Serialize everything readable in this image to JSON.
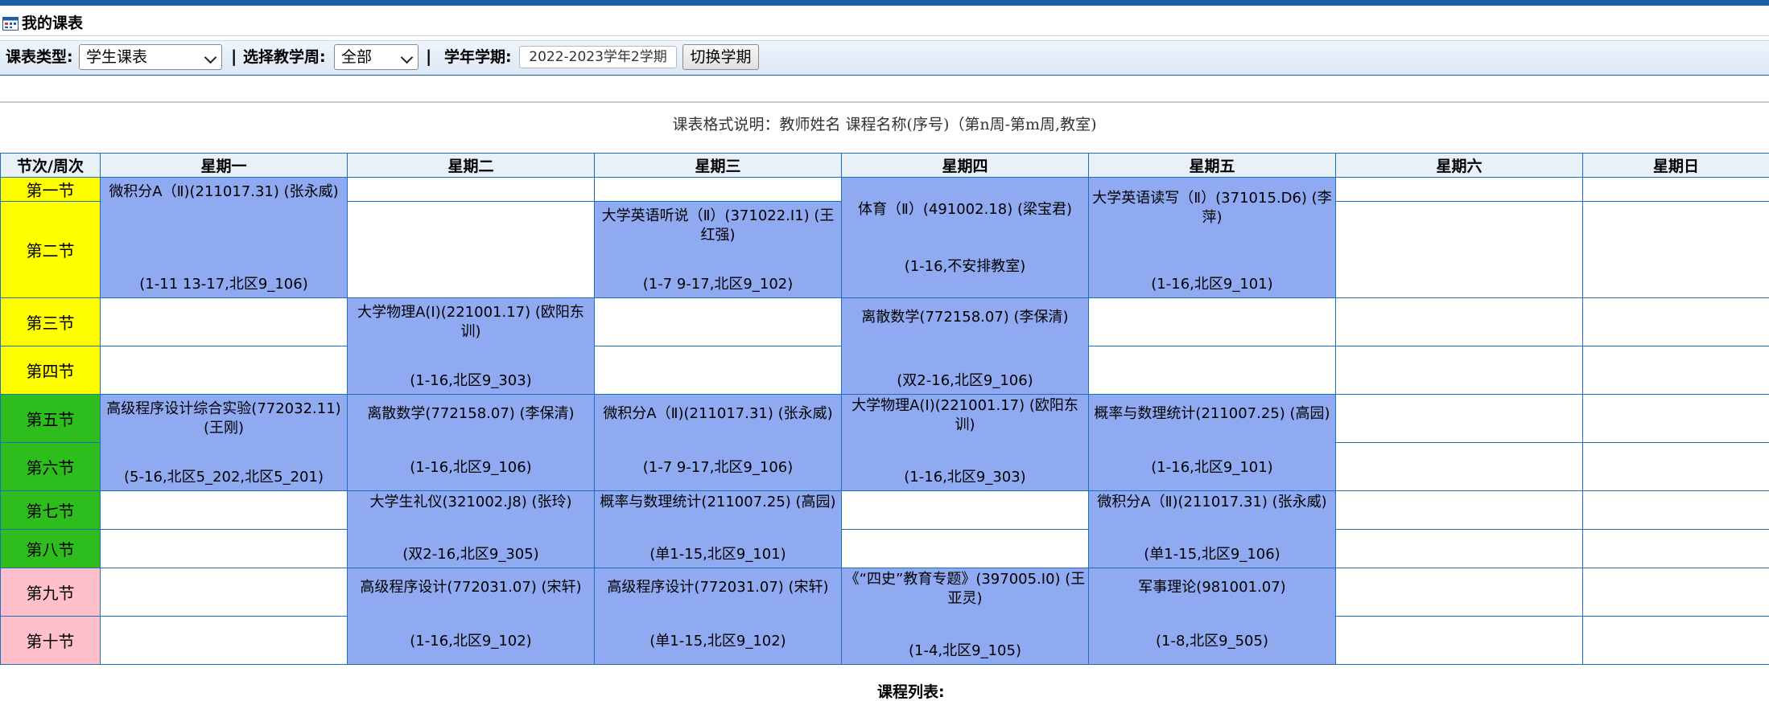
{
  "page": {
    "title": "我的课表"
  },
  "toolbar": {
    "type_label": "课表类型:",
    "type_value": "学生课表",
    "sep1": "|",
    "week_label": "选择教学周:",
    "week_value": "全部",
    "sep2": "|",
    "term_label": "学年学期:",
    "term_value": "2022-2023学年2学期",
    "switch_button": "切换学期"
  },
  "format_note": "课表格式说明：教师姓名 课程名称(序号)（第n周-第m周,教室)",
  "table": {
    "corner_header": "节次/周次",
    "days": [
      "星期一",
      "星期二",
      "星期三",
      "星期四",
      "星期五",
      "星期六",
      "星期日"
    ],
    "periods": [
      "第一节",
      "第二节",
      "第三节",
      "第四节",
      "第五节",
      "第六节",
      "第七节",
      "第八节",
      "第九节",
      "第十节"
    ],
    "courses": {
      "mon_2": {
        "name": "微积分A（Ⅱ)(211017.31) (张永威)",
        "time": "(1-11 13-17,北区9_106)"
      },
      "mon_5": {
        "name": "高级程序设计综合实验(772032.11) (王刚)",
        "time": "(5-16,北区5_202,北区5_201)"
      },
      "tue_3": {
        "name": "大学物理A(I)(221001.17) (欧阳东训)",
        "time": "(1-16,北区9_303)"
      },
      "tue_5": {
        "name": "离散数学(772158.07) (李保清)",
        "time": "(1-16,北区9_106)"
      },
      "tue_7": {
        "name": "大学生礼仪(321002.J8) (张玲)",
        "time": "(双2-16,北区9_305)"
      },
      "tue_9": {
        "name": "高级程序设计(772031.07) (宋轩)",
        "time": "(1-16,北区9_102)"
      },
      "wed_2": {
        "name": "大学英语听说（Ⅱ）(371022.I1) (王红强)",
        "time": "(1-7 9-17,北区9_102)"
      },
      "wed_5": {
        "name": "微积分A（Ⅱ)(211017.31) (张永威)",
        "time": "(1-7 9-17,北区9_106)"
      },
      "wed_7": {
        "name": "概率与数理统计(211007.25) (高园)",
        "time": "(单1-15,北区9_101)"
      },
      "wed_9": {
        "name": "高级程序设计(772031.07) (宋轩)",
        "time": "(单1-15,北区9_102)"
      },
      "thu_1": {
        "name": "体育（Ⅱ）(491002.18) (梁宝君)",
        "time": "(1-16,不安排教室)"
      },
      "thu_3": {
        "name": "离散数学(772158.07) (李保清)",
        "time": "(双2-16,北区9_106)"
      },
      "thu_5": {
        "name": "大学物理A(I)(221001.17) (欧阳东训)",
        "time": "(1-16,北区9_303)"
      },
      "thu_9": {
        "name": "《“四史”教育专题》(397005.I0) (王亚灵)",
        "time": "(1-4,北区9_105)"
      },
      "fri_1": {
        "name": "大学英语读写（Ⅱ）(371015.D6) (李萍)",
        "time": "(1-16,北区9_101)"
      },
      "fri_5": {
        "name": "概率与数理统计(211007.25) (高园)",
        "time": "(1-16,北区9_101)"
      },
      "fri_7": {
        "name": "微积分A（Ⅱ)(211017.31) (张永威)",
        "time": "(单1-15,北区9_106)"
      },
      "fri_9": {
        "name": "军事理论(981001.07)",
        "time": "(1-8,北区9_505)"
      }
    }
  },
  "bottom_heading": "课程列表:",
  "colors": {
    "course_bg": "#90aaf2",
    "period_yellow": "#ffff00",
    "period_green": "#2dbe1d",
    "period_pink": "#ffc0cb",
    "border": "#1a6fc0",
    "top_bar": "#1a5fa8"
  }
}
